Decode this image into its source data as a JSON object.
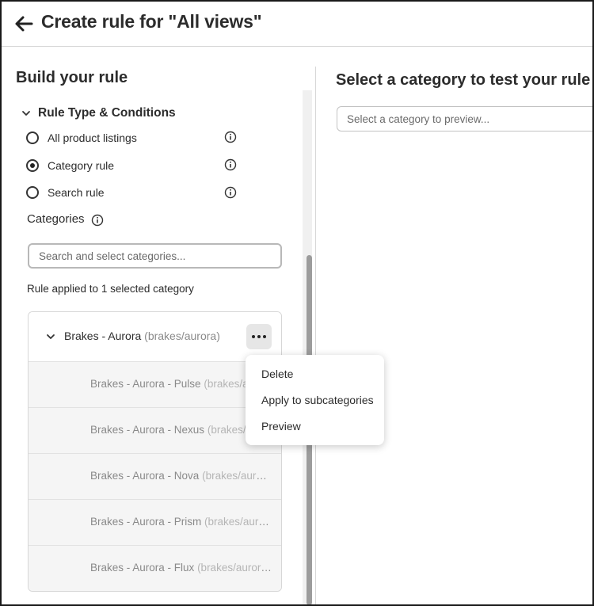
{
  "header": {
    "title": "Create rule for \"All views\""
  },
  "left_panel": {
    "title": "Build your rule",
    "section_label": "Rule Type & Conditions",
    "radio_options": [
      {
        "label": "All product listings",
        "checked": false
      },
      {
        "label": "Category rule",
        "checked": true
      },
      {
        "label": "Search rule",
        "checked": false
      }
    ],
    "categories_label": "Categories",
    "categories_search_placeholder": "Search and select categories...",
    "applied_text": "Rule applied to 1 selected category",
    "parent_category": {
      "name": "Brakes - Aurora",
      "path": "(brakes/aurora)"
    },
    "subcategories": [
      {
        "name": "Brakes - Aurora - Pulse",
        "path": "(brakes/au"
      },
      {
        "name": "Brakes - Aurora - Nexus",
        "path": "(brakes/au"
      },
      {
        "name": "Brakes - Aurora - Nova",
        "path": "(brakes/auror..."
      },
      {
        "name": "Brakes - Aurora - Prism",
        "path": "(brakes/auror..."
      },
      {
        "name": "Brakes - Aurora - Flux",
        "path": "(brakes/aurora..."
      }
    ]
  },
  "right_panel": {
    "title": "Select a category to test your rule",
    "preview_placeholder": "Select a category to preview..."
  },
  "context_menu": {
    "items": [
      "Delete",
      "Apply to subcategories",
      "Preview"
    ]
  },
  "icons": {
    "back": "arrow-left-icon",
    "chevron": "chevron-down-icon",
    "info": "info-icon",
    "more": "more-horizontal-icon"
  },
  "colors": {
    "text": "#2c2c2c",
    "muted_text": "#8a8a8a",
    "border": "#d7d7d7",
    "child_row_bg": "#f5f5f5",
    "more_button_bg": "#e6e6e6"
  }
}
